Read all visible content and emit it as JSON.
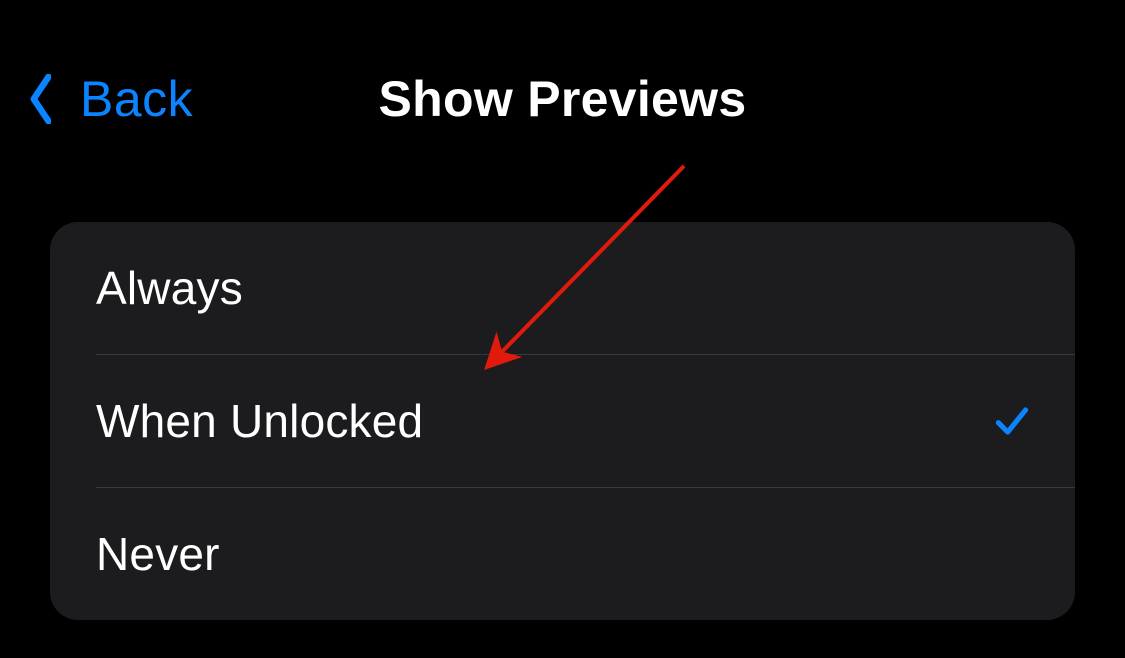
{
  "nav": {
    "back_label": "Back",
    "title": "Show Previews"
  },
  "options": [
    {
      "label": "Always",
      "selected": false
    },
    {
      "label": "When Unlocked",
      "selected": true
    },
    {
      "label": "Never",
      "selected": false
    }
  ],
  "colors": {
    "accent": "#0a84ff",
    "list_bg": "#1c1c1e",
    "annotation": "#e11b0c"
  }
}
